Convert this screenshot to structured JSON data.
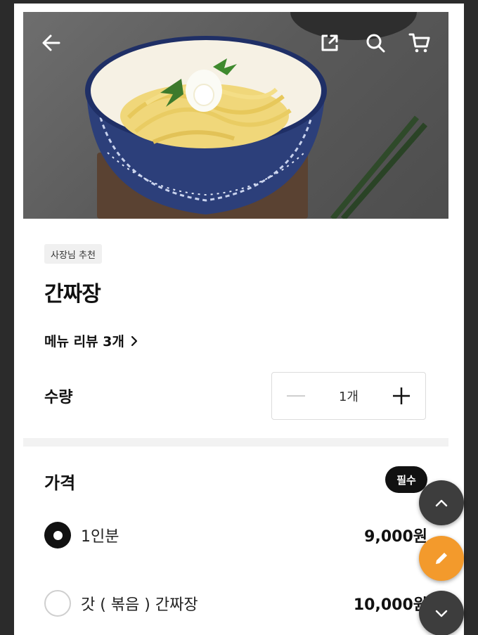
{
  "header": {
    "back_icon": "arrow-left-icon",
    "share_icon": "share-icon",
    "search_icon": "search-icon",
    "cart_icon": "cart-icon"
  },
  "menu": {
    "badge": "사장님 추천",
    "name": "간짜장",
    "review_link": "메뉴 리뷰 3개",
    "quantity_label": "수량",
    "quantity_value": "1개"
  },
  "price_section": {
    "label": "가격",
    "required_badge": "필수",
    "options": [
      {
        "name": "1인분",
        "price": "9,000원",
        "selected": true
      },
      {
        "name": "갓 ( 볶음 ) 간짜장",
        "price": "10,000원",
        "selected": false
      }
    ]
  },
  "floating": {
    "up_icon": "chevron-up-icon",
    "edit_icon": "pencil-icon",
    "down_icon": "chevron-down-icon"
  },
  "colors": {
    "accent": "#f39a2c",
    "dark_fab": "#3d3d3d",
    "text": "#111111"
  }
}
